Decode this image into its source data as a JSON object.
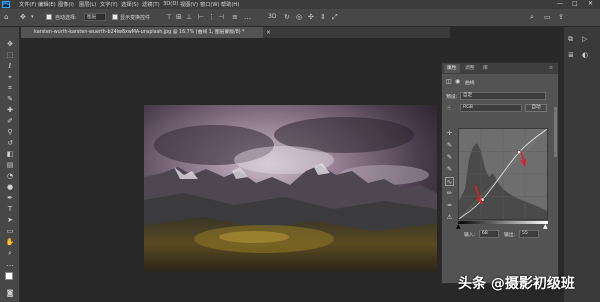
{
  "app": {
    "logo_text": "Ps"
  },
  "menu": [
    "文件(F)",
    "编辑(E)",
    "图像(I)",
    "图层(L)",
    "文字(Y)",
    "选择(S)",
    "滤镜(T)",
    "3D(D)",
    "视图(V)",
    "窗口(W)",
    "帮助(H)"
  ],
  "window_controls": {
    "minimize": "—",
    "maximize": "□",
    "close": "✕"
  },
  "options_bar": {
    "auto_select_label": "自动选择:",
    "auto_select_value": "图层",
    "show_transform_label": "显示变换控件"
  },
  "document": {
    "tab_title": "karsten-wurth-karsten-wuerth-b24lw8xwMA-unsplash.jpg @ 16.7% (曲线 1, 图层蒙版/8) *",
    "close": "×"
  },
  "properties_panel": {
    "tabs": [
      "属性",
      "调整",
      "库"
    ],
    "header_label": "曲线",
    "preset_label": "预设:",
    "preset_value": "自定",
    "channel_value": "RGB",
    "auto_button": "自动",
    "input_label": "输入:",
    "input_value": "68",
    "output_label": "输出:",
    "output_value": "55"
  },
  "curve": {
    "control_points": [
      {
        "input": 0,
        "output": 0
      },
      {
        "input": 68,
        "output": 55
      },
      {
        "input": 174,
        "output": 189
      },
      {
        "input": 255,
        "output": 255
      }
    ]
  },
  "watermark": {
    "text": "头条 @摄影初级班"
  },
  "colors": {
    "accent": "#31a8ff",
    "annotation_arrow": "#e02020"
  }
}
